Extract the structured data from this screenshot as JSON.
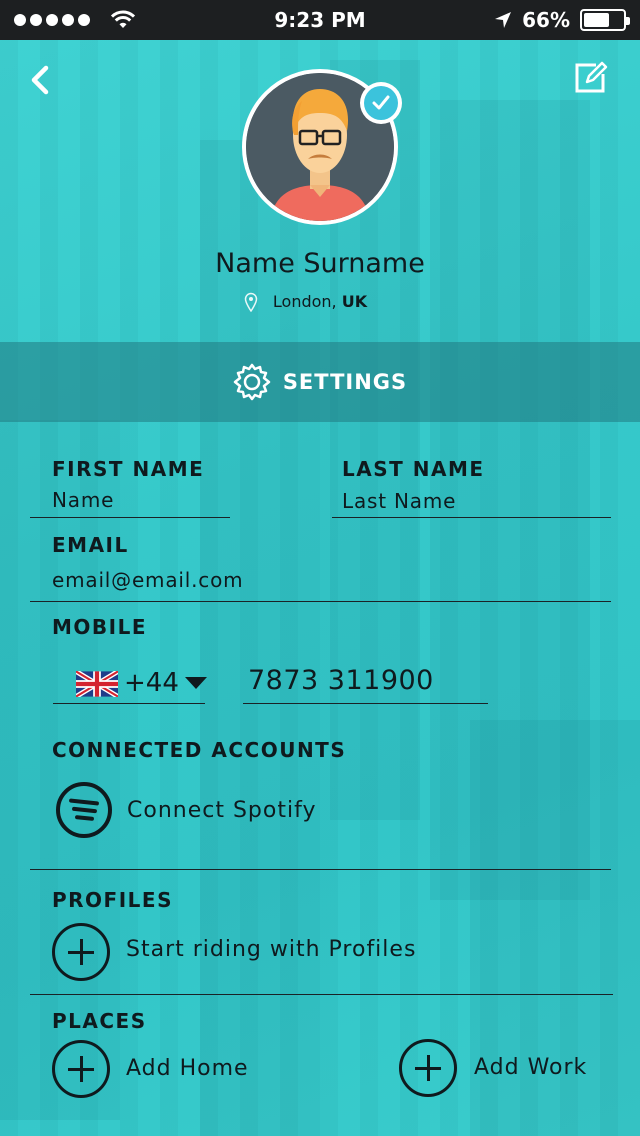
{
  "status_bar": {
    "time": "9:23 PM",
    "battery_percent": "66%",
    "battery_level": 0.66,
    "signal_dots": 5
  },
  "header": {
    "back_icon": "chevron-left-icon",
    "edit_icon": "edit-icon"
  },
  "profile": {
    "name": "Name Surname",
    "city": "London, ",
    "country": "UK",
    "verified": true
  },
  "settings": {
    "title": "SETTINGS"
  },
  "form": {
    "first_name_label": "FIRST NAME",
    "first_name_value": "Name",
    "last_name_label": "LAST NAME",
    "last_name_value": "Last Name",
    "email_label": "EMAIL",
    "email_value": "email@email.com",
    "mobile_label": "MOBILE",
    "country_code": "+44",
    "phone_value": "7873 311900"
  },
  "connected_accounts": {
    "label": "CONNECTED ACCOUNTS",
    "spotify_label": "Connect Spotify"
  },
  "profiles": {
    "label": "PROFILES",
    "action_label": "Start riding with Profiles"
  },
  "places": {
    "label": "PLACES",
    "home_label": "Add Home",
    "work_label": "Add Work"
  },
  "colors": {
    "background": "#3ccfd0",
    "settings_bar": "#207a82",
    "verified": "#3bc3dc",
    "text": "#0f1a1e"
  }
}
